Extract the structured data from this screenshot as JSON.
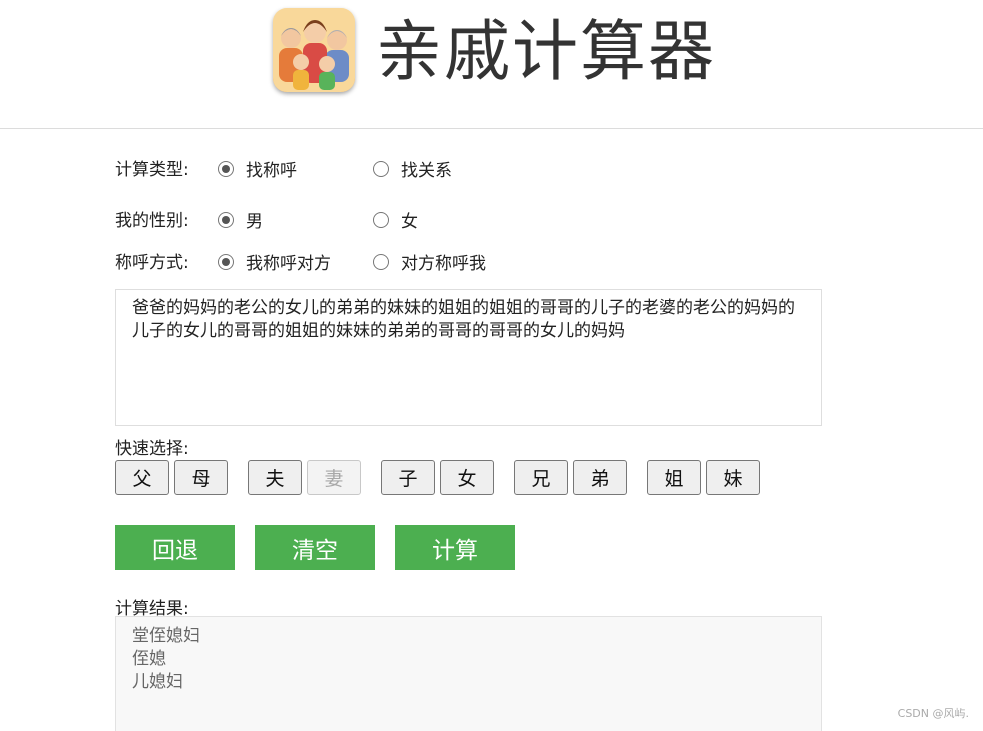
{
  "header": {
    "title": "亲戚计算器",
    "logo_icon": "family-icon"
  },
  "form": {
    "type": {
      "label": "计算类型:",
      "options": [
        "找称呼",
        "找关系"
      ],
      "selected": "找称呼"
    },
    "gender": {
      "label": "我的性别:",
      "options": [
        "男",
        "女"
      ],
      "selected": "男"
    },
    "mode": {
      "label": "称呼方式:",
      "options": [
        "我称呼对方",
        "对方称呼我"
      ],
      "selected": "我称呼对方"
    },
    "input_text": "爸爸的妈妈的老公的女儿的弟弟的妹妹的姐姐的姐姐的哥哥的儿子的老婆的老公的妈妈的儿子的女儿的哥哥的姐姐的妹妹的弟弟的哥哥的哥哥的女儿的妈妈"
  },
  "quick_select": {
    "label": "快速选择:",
    "buttons": [
      {
        "label": "父",
        "disabled": false
      },
      {
        "label": "母",
        "disabled": false
      },
      {
        "label": "夫",
        "disabled": false
      },
      {
        "label": "妻",
        "disabled": true
      },
      {
        "label": "子",
        "disabled": false
      },
      {
        "label": "女",
        "disabled": false
      },
      {
        "label": "兄",
        "disabled": false
      },
      {
        "label": "弟",
        "disabled": false
      },
      {
        "label": "姐",
        "disabled": false
      },
      {
        "label": "妹",
        "disabled": false
      }
    ]
  },
  "actions": {
    "back": "回退",
    "clear": "清空",
    "calculate": "计算",
    "color": "#4caf50"
  },
  "result": {
    "label": "计算结果:",
    "lines": [
      "堂侄媳妇",
      "侄媳",
      "儿媳妇"
    ]
  },
  "watermark": "CSDN @风屿."
}
